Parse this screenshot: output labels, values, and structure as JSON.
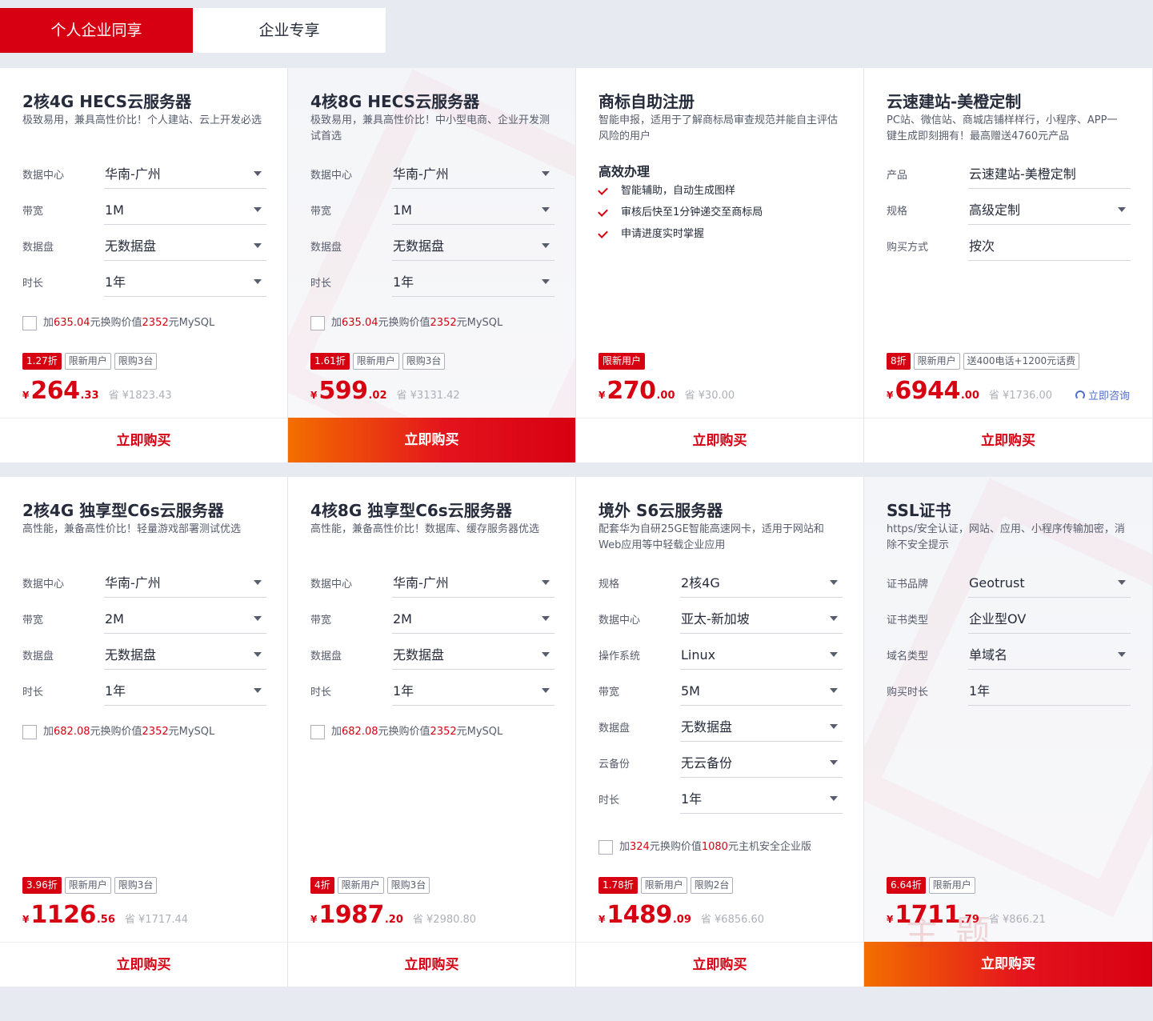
{
  "tabs": [
    "个人企业同享",
    "企业专享"
  ],
  "cards": [
    {
      "title": "2核4G HECS云服务器",
      "desc": "极致易用，兼具高性价比！个人建站、云上开发必选",
      "fields": [
        {
          "label": "数据中心",
          "value": "华南-广州"
        },
        {
          "label": "带宽",
          "value": "1M"
        },
        {
          "label": "数据盘",
          "value": "无数据盘"
        },
        {
          "label": "时长",
          "value": "1年"
        }
      ],
      "addon": {
        "pre": "加",
        "num1": "635.04",
        "mid": "元换购价值",
        "num2": "2352",
        "post": "元MySQL"
      },
      "badges": [
        "1.27折",
        "限新用户",
        "限购3台"
      ],
      "price": {
        "yen": "¥",
        "int": "264",
        "dec": ".33",
        "save": "省 ¥1823.43"
      },
      "buy": "立即购买"
    },
    {
      "title": "4核8G HECS云服务器",
      "desc": "极致易用，兼具高性价比！中小型电商、企业开发测试首选",
      "fields": [
        {
          "label": "数据中心",
          "value": "华南-广州"
        },
        {
          "label": "带宽",
          "value": "1M"
        },
        {
          "label": "数据盘",
          "value": "无数据盘"
        },
        {
          "label": "时长",
          "value": "1年"
        }
      ],
      "addon": {
        "pre": "加",
        "num1": "635.04",
        "mid": "元换购价值",
        "num2": "2352",
        "post": "元MySQL"
      },
      "badges": [
        "1.61折",
        "限新用户",
        "限购3台"
      ],
      "price": {
        "yen": "¥",
        "int": "599",
        "dec": ".02",
        "save": "省 ¥3131.42"
      },
      "buy": "立即购买"
    },
    {
      "title": "商标自助注册",
      "desc": "智能申报，适用于了解商标局审查规范并能自主评估风险的用户",
      "features_title": "高效办理",
      "features": [
        "智能辅助，自动生成图样",
        "审核后快至1分钟递交至商标局",
        "申请进度实时掌握"
      ],
      "badges": [
        "限新用户"
      ],
      "price": {
        "yen": "¥",
        "int": "270",
        "dec": ".00",
        "save": "省 ¥30.00"
      },
      "buy": "立即购买"
    },
    {
      "title": "云速建站-美橙定制",
      "desc": "PC站、微信站、商城店铺样样行，小程序、APP一键生成即刻拥有！最高赠送4760元产品",
      "fields": [
        {
          "label": "产品",
          "value": "云速建站-美橙定制"
        },
        {
          "label": "规格",
          "value": "高级定制"
        },
        {
          "label": "购买方式",
          "value": "按次"
        }
      ],
      "badges": [
        "8折",
        "限新用户",
        "送400电话+1200元话费"
      ],
      "price": {
        "yen": "¥",
        "int": "6944",
        "dec": ".00",
        "save": "省 ¥1736.00"
      },
      "consult": "立即咨询",
      "buy": "立即购买"
    },
    {
      "title": "2核4G 独享型C6s云服务器",
      "desc": "高性能，兼备高性价比！轻量游戏部署测试优选",
      "fields": [
        {
          "label": "数据中心",
          "value": "华南-广州"
        },
        {
          "label": "带宽",
          "value": "2M"
        },
        {
          "label": "数据盘",
          "value": "无数据盘"
        },
        {
          "label": "时长",
          "value": "1年"
        }
      ],
      "addon": {
        "pre": "加",
        "num1": "682.08",
        "mid": "元换购价值",
        "num2": "2352",
        "post": "元MySQL"
      },
      "badges": [
        "3.96折",
        "限新用户",
        "限购3台"
      ],
      "price": {
        "yen": "¥",
        "int": "1126",
        "dec": ".56",
        "save": "省 ¥1717.44"
      },
      "buy": "立即购买"
    },
    {
      "title": "4核8G 独享型C6s云服务器",
      "desc": "高性能，兼备高性价比！数据库、缓存服务器优选",
      "fields": [
        {
          "label": "数据中心",
          "value": "华南-广州"
        },
        {
          "label": "带宽",
          "value": "2M"
        },
        {
          "label": "数据盘",
          "value": "无数据盘"
        },
        {
          "label": "时长",
          "value": "1年"
        }
      ],
      "addon": {
        "pre": "加",
        "num1": "682.08",
        "mid": "元换购价值",
        "num2": "2352",
        "post": "元MySQL"
      },
      "badges": [
        "4折",
        "限新用户",
        "限购3台"
      ],
      "price": {
        "yen": "¥",
        "int": "1987",
        "dec": ".20",
        "save": "省 ¥2980.80"
      },
      "buy": "立即购买"
    },
    {
      "title": "境外 S6云服务器",
      "desc": "配套华为自研25GE智能高速网卡，适用于网站和Web应用等中轻载企业应用",
      "fields": [
        {
          "label": "规格",
          "value": "2核4G"
        },
        {
          "label": "数据中心",
          "value": "亚太-新加坡"
        },
        {
          "label": "操作系统",
          "value": "Linux"
        },
        {
          "label": "带宽",
          "value": "5M"
        },
        {
          "label": "数据盘",
          "value": "无数据盘"
        },
        {
          "label": "云备份",
          "value": "无云备份"
        },
        {
          "label": "时长",
          "value": "1年"
        }
      ],
      "addon": {
        "pre": "加",
        "num1": "324",
        "mid": "元换购价值",
        "num2": "1080",
        "post": "元主机安全企业版"
      },
      "badges": [
        "1.78折",
        "限新用户",
        "限购2台"
      ],
      "price": {
        "yen": "¥",
        "int": "1489",
        "dec": ".09",
        "save": "省 ¥6856.60"
      },
      "buy": "立即购买"
    },
    {
      "title": "SSL证书",
      "desc": "https/安全认证，网站、应用、小程序传输加密，消除不安全提示",
      "fields": [
        {
          "label": "证书品牌",
          "value": "Geotrust"
        },
        {
          "label": "证书类型",
          "value": "企业型OV"
        },
        {
          "label": "域名类型",
          "value": "单域名"
        },
        {
          "label": "购买时长",
          "value": "1年"
        }
      ],
      "badges": [
        "6.64折",
        "限新用户"
      ],
      "price": {
        "yen": "¥",
        "int": "1711",
        "dec": ".79",
        "save": "省 ¥866.21"
      },
      "buy": "立即购买"
    }
  ],
  "watermark": "主题",
  "colors": {
    "accent": "#d70012",
    "gradient_start": "#f36f00",
    "link": "#526ecc"
  }
}
